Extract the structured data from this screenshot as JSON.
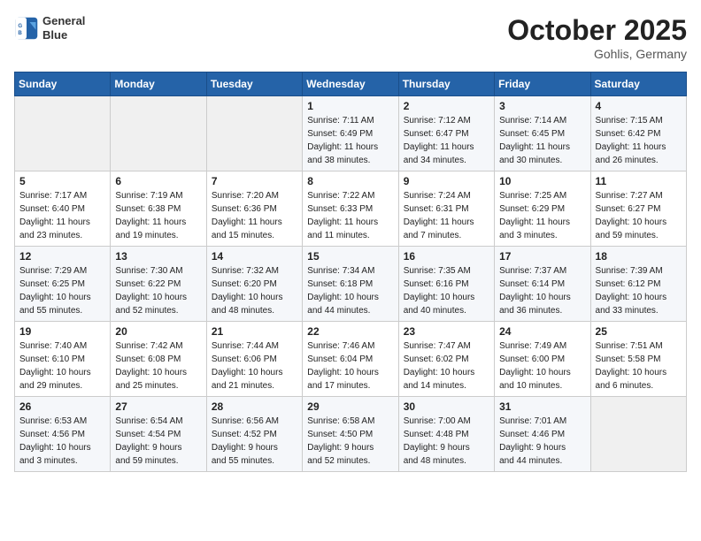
{
  "header": {
    "logo_line1": "General",
    "logo_line2": "Blue",
    "month": "October 2025",
    "location": "Gohlis, Germany"
  },
  "days_of_week": [
    "Sunday",
    "Monday",
    "Tuesday",
    "Wednesday",
    "Thursday",
    "Friday",
    "Saturday"
  ],
  "weeks": [
    [
      {
        "num": "",
        "info": ""
      },
      {
        "num": "",
        "info": ""
      },
      {
        "num": "",
        "info": ""
      },
      {
        "num": "1",
        "info": "Sunrise: 7:11 AM\nSunset: 6:49 PM\nDaylight: 11 hours\nand 38 minutes."
      },
      {
        "num": "2",
        "info": "Sunrise: 7:12 AM\nSunset: 6:47 PM\nDaylight: 11 hours\nand 34 minutes."
      },
      {
        "num": "3",
        "info": "Sunrise: 7:14 AM\nSunset: 6:45 PM\nDaylight: 11 hours\nand 30 minutes."
      },
      {
        "num": "4",
        "info": "Sunrise: 7:15 AM\nSunset: 6:42 PM\nDaylight: 11 hours\nand 26 minutes."
      }
    ],
    [
      {
        "num": "5",
        "info": "Sunrise: 7:17 AM\nSunset: 6:40 PM\nDaylight: 11 hours\nand 23 minutes."
      },
      {
        "num": "6",
        "info": "Sunrise: 7:19 AM\nSunset: 6:38 PM\nDaylight: 11 hours\nand 19 minutes."
      },
      {
        "num": "7",
        "info": "Sunrise: 7:20 AM\nSunset: 6:36 PM\nDaylight: 11 hours\nand 15 minutes."
      },
      {
        "num": "8",
        "info": "Sunrise: 7:22 AM\nSunset: 6:33 PM\nDaylight: 11 hours\nand 11 minutes."
      },
      {
        "num": "9",
        "info": "Sunrise: 7:24 AM\nSunset: 6:31 PM\nDaylight: 11 hours\nand 7 minutes."
      },
      {
        "num": "10",
        "info": "Sunrise: 7:25 AM\nSunset: 6:29 PM\nDaylight: 11 hours\nand 3 minutes."
      },
      {
        "num": "11",
        "info": "Sunrise: 7:27 AM\nSunset: 6:27 PM\nDaylight: 10 hours\nand 59 minutes."
      }
    ],
    [
      {
        "num": "12",
        "info": "Sunrise: 7:29 AM\nSunset: 6:25 PM\nDaylight: 10 hours\nand 55 minutes."
      },
      {
        "num": "13",
        "info": "Sunrise: 7:30 AM\nSunset: 6:22 PM\nDaylight: 10 hours\nand 52 minutes."
      },
      {
        "num": "14",
        "info": "Sunrise: 7:32 AM\nSunset: 6:20 PM\nDaylight: 10 hours\nand 48 minutes."
      },
      {
        "num": "15",
        "info": "Sunrise: 7:34 AM\nSunset: 6:18 PM\nDaylight: 10 hours\nand 44 minutes."
      },
      {
        "num": "16",
        "info": "Sunrise: 7:35 AM\nSunset: 6:16 PM\nDaylight: 10 hours\nand 40 minutes."
      },
      {
        "num": "17",
        "info": "Sunrise: 7:37 AM\nSunset: 6:14 PM\nDaylight: 10 hours\nand 36 minutes."
      },
      {
        "num": "18",
        "info": "Sunrise: 7:39 AM\nSunset: 6:12 PM\nDaylight: 10 hours\nand 33 minutes."
      }
    ],
    [
      {
        "num": "19",
        "info": "Sunrise: 7:40 AM\nSunset: 6:10 PM\nDaylight: 10 hours\nand 29 minutes."
      },
      {
        "num": "20",
        "info": "Sunrise: 7:42 AM\nSunset: 6:08 PM\nDaylight: 10 hours\nand 25 minutes."
      },
      {
        "num": "21",
        "info": "Sunrise: 7:44 AM\nSunset: 6:06 PM\nDaylight: 10 hours\nand 21 minutes."
      },
      {
        "num": "22",
        "info": "Sunrise: 7:46 AM\nSunset: 6:04 PM\nDaylight: 10 hours\nand 17 minutes."
      },
      {
        "num": "23",
        "info": "Sunrise: 7:47 AM\nSunset: 6:02 PM\nDaylight: 10 hours\nand 14 minutes."
      },
      {
        "num": "24",
        "info": "Sunrise: 7:49 AM\nSunset: 6:00 PM\nDaylight: 10 hours\nand 10 minutes."
      },
      {
        "num": "25",
        "info": "Sunrise: 7:51 AM\nSunset: 5:58 PM\nDaylight: 10 hours\nand 6 minutes."
      }
    ],
    [
      {
        "num": "26",
        "info": "Sunrise: 6:53 AM\nSunset: 4:56 PM\nDaylight: 10 hours\nand 3 minutes."
      },
      {
        "num": "27",
        "info": "Sunrise: 6:54 AM\nSunset: 4:54 PM\nDaylight: 9 hours\nand 59 minutes."
      },
      {
        "num": "28",
        "info": "Sunrise: 6:56 AM\nSunset: 4:52 PM\nDaylight: 9 hours\nand 55 minutes."
      },
      {
        "num": "29",
        "info": "Sunrise: 6:58 AM\nSunset: 4:50 PM\nDaylight: 9 hours\nand 52 minutes."
      },
      {
        "num": "30",
        "info": "Sunrise: 7:00 AM\nSunset: 4:48 PM\nDaylight: 9 hours\nand 48 minutes."
      },
      {
        "num": "31",
        "info": "Sunrise: 7:01 AM\nSunset: 4:46 PM\nDaylight: 9 hours\nand 44 minutes."
      },
      {
        "num": "",
        "info": ""
      }
    ]
  ]
}
